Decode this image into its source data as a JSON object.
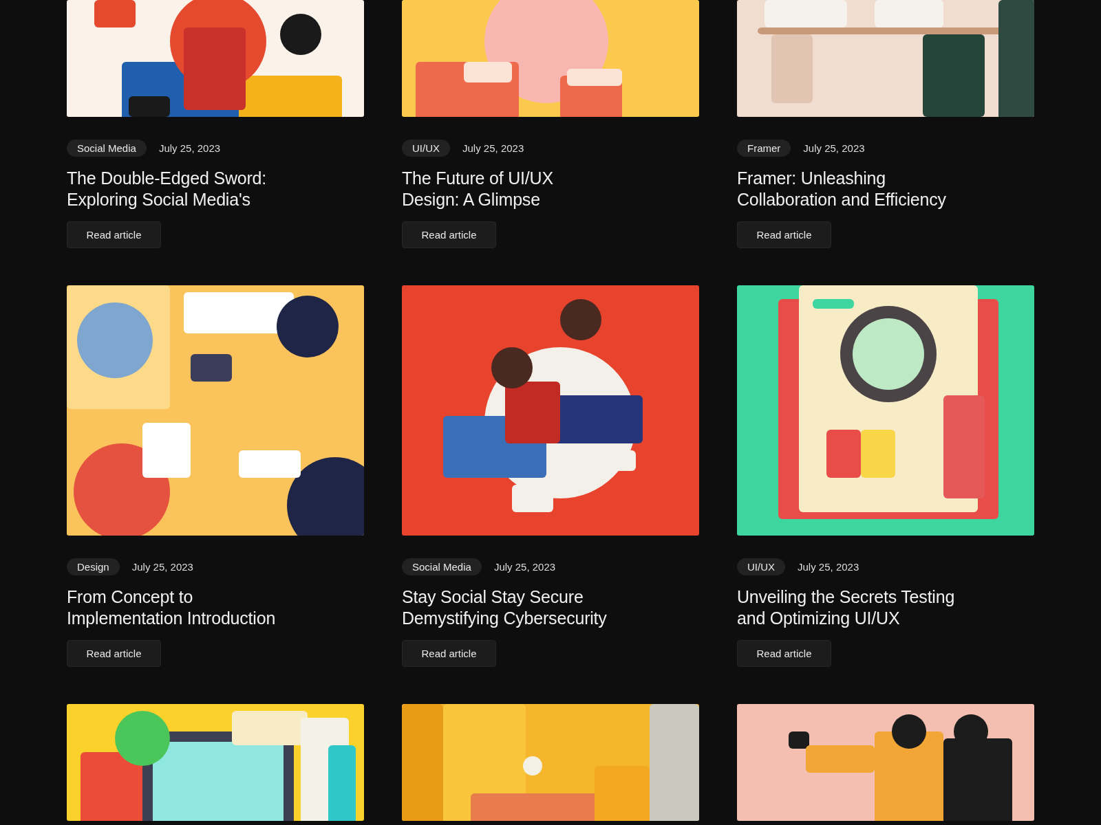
{
  "articles": [
    {
      "picture": {
        "kind": "picture"
      },
      "tag": "Social Media",
      "date": "July 25, 2023",
      "title": "The Double-Edged Sword:\nExploring Social Media's",
      "button": "Read article"
    },
    {
      "picture": {
        "kind": "picture"
      },
      "tag": "UI/UX",
      "date": "July 25, 2023",
      "title": "The Future of UI/UX\nDesign: A Glimpse",
      "button": "Read article"
    },
    {
      "picture": {
        "kind": "picture"
      },
      "tag": "Framer",
      "date": "July 25, 2023",
      "title": "Framer: Unleashing\nCollaboration and Efficiency",
      "button": "Read article"
    },
    {
      "picture": {
        "kind": "picture"
      },
      "tag": "Design",
      "date": "July 25, 2023",
      "title": "From Concept to\nImplementation Introduction",
      "button": "Read article"
    },
    {
      "picture": {
        "kind": "picture"
      },
      "tag": "Social Media",
      "date": "July 25, 2023",
      "title": "Stay Social Stay Secure\nDemystifying Cybersecurity",
      "button": "Read article"
    },
    {
      "picture": {
        "kind": "picture"
      },
      "tag": "UI/UX",
      "date": "July 25, 2023",
      "title": "Unveiling the Secrets Testing\nand Optimizing UI/UX",
      "button": "Read article"
    },
    {
      "picture": {
        "kind": "picture"
      }
    },
    {
      "picture": {
        "kind": "picture"
      }
    },
    {
      "picture": {
        "kind": "picture"
      }
    }
  ]
}
